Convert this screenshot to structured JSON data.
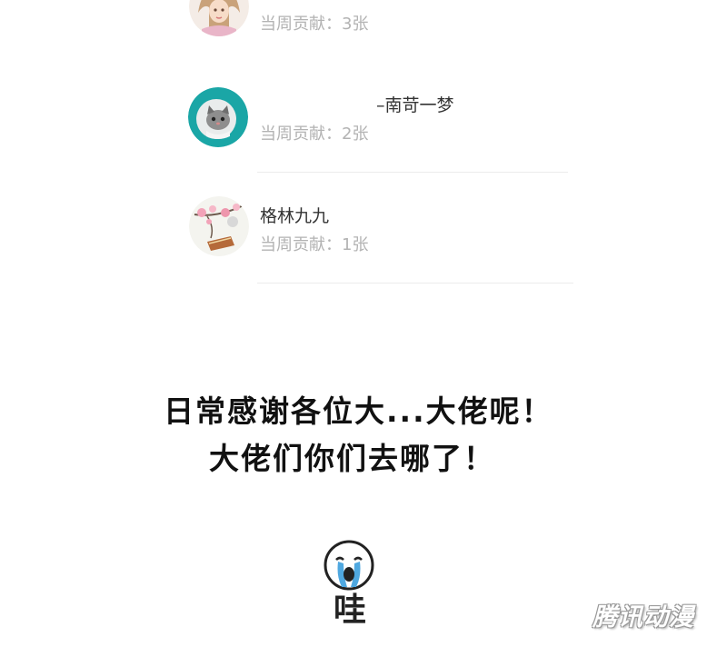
{
  "ranking": {
    "entries": [
      {
        "name": "",
        "contribution": "当周贡献：3张",
        "avatar_icon": "girl-portrait-avatar-icon"
      },
      {
        "name": "–南苛一梦",
        "contribution": "当周贡献：2张",
        "avatar_icon": "cat-avatar-icon",
        "accent": "#1aa6a6"
      },
      {
        "name": "格林九九",
        "contribution": "当周贡献：1张",
        "avatar_icon": "plum-blossom-avatar-icon"
      }
    ]
  },
  "message": {
    "line1": "日常感谢各位大...大佬呢！",
    "line2": "大佬们你们去哪了！"
  },
  "sticker": {
    "icon": "crying-face-sticker-icon",
    "text": "哇"
  },
  "watermark": {
    "text": "腾讯动漫"
  }
}
